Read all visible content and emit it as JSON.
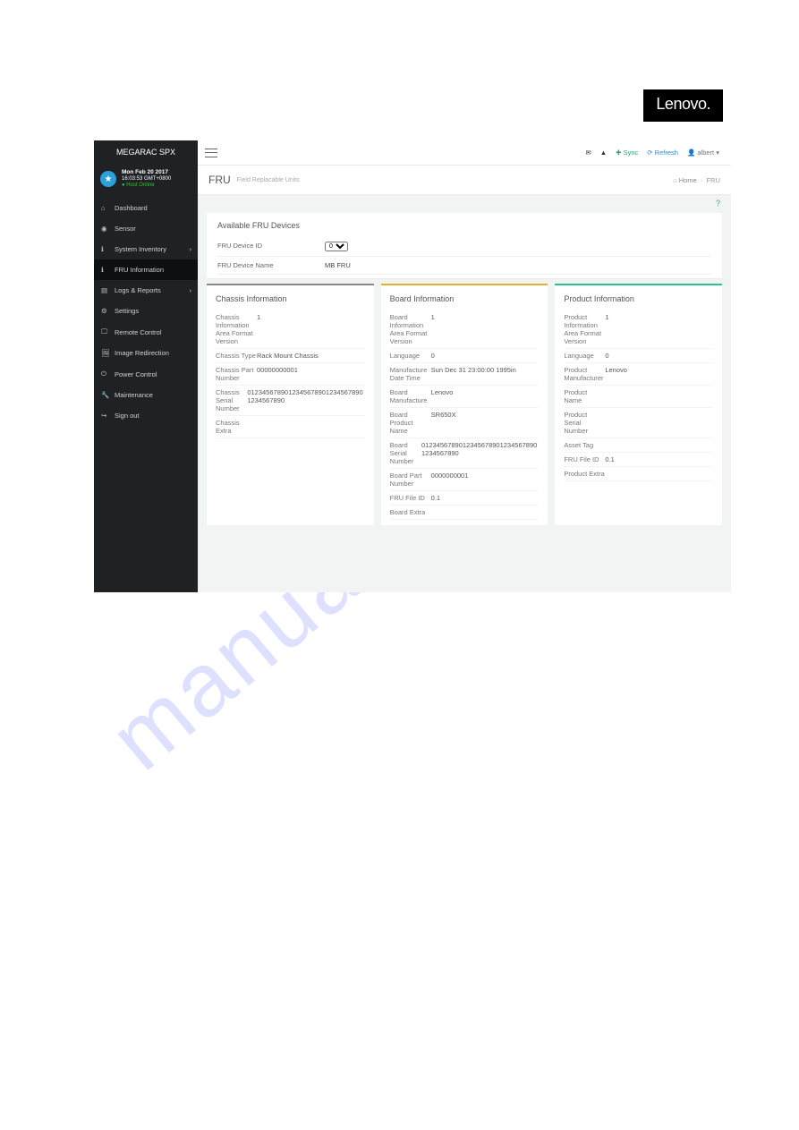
{
  "brand": "Lenovo",
  "watermark": "manualslive.com",
  "topbar": {
    "sync": "Sync",
    "refresh": "Refresh",
    "user": "albert"
  },
  "sidebar": {
    "title": "MEGARAC SPX",
    "date_line1": "Mon Feb 20 2017",
    "date_line2": "16:03:53 GMT+0800",
    "host": "Host Online",
    "items": [
      {
        "icon": "home",
        "label": "Dashboard"
      },
      {
        "icon": "gauge",
        "label": "Sensor"
      },
      {
        "icon": "info",
        "label": "System Inventory",
        "caret": true
      },
      {
        "icon": "info",
        "label": "FRU Information",
        "active": true
      },
      {
        "icon": "chart",
        "label": "Logs & Reports",
        "caret": true
      },
      {
        "icon": "gear",
        "label": "Settings"
      },
      {
        "icon": "monitor",
        "label": "Remote Control"
      },
      {
        "icon": "image",
        "label": "Image Redirection"
      },
      {
        "icon": "power",
        "label": "Power Control"
      },
      {
        "icon": "wrench",
        "label": "Maintenance"
      },
      {
        "icon": "signout",
        "label": "Sign out"
      }
    ]
  },
  "page": {
    "title": "FRU",
    "subtitle": "Field Replacable Units",
    "breadcrumb_home": "Home",
    "breadcrumb_current": "FRU"
  },
  "available": {
    "heading": "Available FRU Devices",
    "device_id_label": "FRU Device ID",
    "device_id_value": "0",
    "device_name_label": "FRU Device Name",
    "device_name_value": "MB FRU"
  },
  "chassis": {
    "heading": "Chassis Information",
    "rows": [
      {
        "k": "Chassis Information Area Format Version",
        "v": "1"
      },
      {
        "k": "Chassis Type",
        "v": "Rack Mount Chassis"
      },
      {
        "k": "Chassis Part Number",
        "v": "00000000001"
      },
      {
        "k": "Chassis Serial Number",
        "v": "01234567890123456789012345678901234567890"
      },
      {
        "k": "Chassis Extra",
        "v": ""
      }
    ]
  },
  "board": {
    "heading": "Board Information",
    "rows": [
      {
        "k": "Board Information Area Format Version",
        "v": "1"
      },
      {
        "k": "Language",
        "v": "0"
      },
      {
        "k": "Manufacture Date Time",
        "v": "Sun Dec 31 23:00:00 1995in"
      },
      {
        "k": "Board Manufacture",
        "v": "Lenovo"
      },
      {
        "k": "Board Product Name",
        "v": "SR650X"
      },
      {
        "k": "Board Serial Number",
        "v": "01234567890123456789012345678901234567890"
      },
      {
        "k": "Board Part Number",
        "v": "0000000001"
      },
      {
        "k": "FRU File ID",
        "v": "0.1"
      },
      {
        "k": "Board Extra",
        "v": ""
      }
    ]
  },
  "product": {
    "heading": "Product Information",
    "rows": [
      {
        "k": "Product Information Area Format Version",
        "v": "1"
      },
      {
        "k": "Language",
        "v": "0"
      },
      {
        "k": "Product Manufacturer",
        "v": "Lenovo"
      },
      {
        "k": "Product Name",
        "v": ""
      },
      {
        "k": "Product Serial Number",
        "v": ""
      },
      {
        "k": "Asset Tag",
        "v": ""
      },
      {
        "k": "FRU File ID",
        "v": "0.1"
      },
      {
        "k": "Product Extra",
        "v": ""
      }
    ]
  }
}
